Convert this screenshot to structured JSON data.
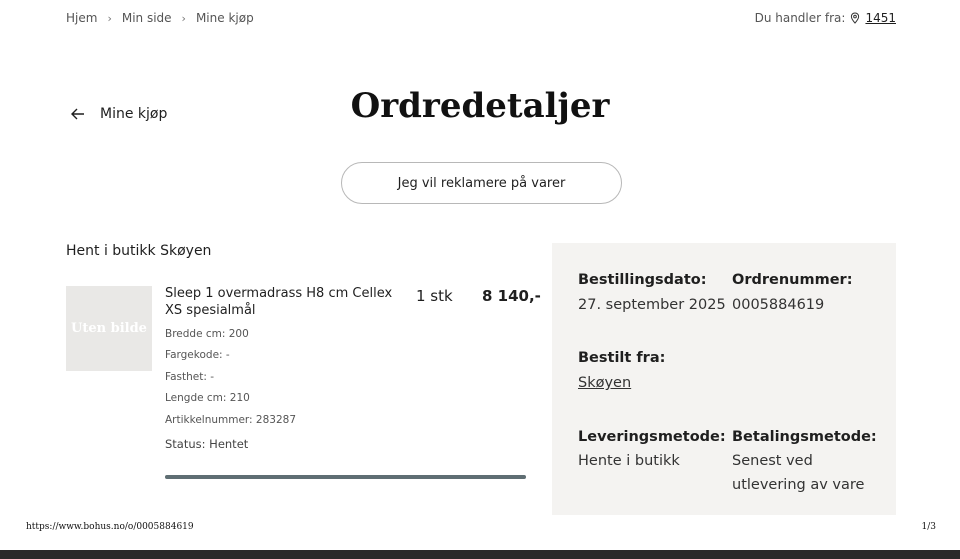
{
  "breadcrumb": {
    "items": [
      "Hjem",
      "Min side",
      "Mine kjøp"
    ]
  },
  "store": {
    "label": "Du handler fra:",
    "icon": "location-pin-icon",
    "name": "1451"
  },
  "header": {
    "back_label": "Mine kjøp",
    "title": "Ordredetaljer"
  },
  "complaint_button": "Jeg vil reklamere på varer",
  "order_lines": {
    "heading": "Hent i butikk Skøyen",
    "item": {
      "image_placeholder": "Uten bilde",
      "name": "Sleep 1 overmadrass H8 cm Cellex XS spesialmål",
      "quantity": "1 stk",
      "price": "8 140,-",
      "attributes": [
        "Bredde cm: 200",
        "Fargekode: -",
        "Fasthet: -",
        "Lengde cm: 210",
        "Artikkelnummer: 283287"
      ],
      "status": "Status: Hentet",
      "progress": 1.0
    }
  },
  "info": {
    "order_date_label": "Bestillingsdato:",
    "order_date_value": "27. september 2025",
    "order_number_label": "Ordrenummer:",
    "order_number_value": "0005884619",
    "ordered_from_label": "Bestilt fra:",
    "ordered_from_value": "Skøyen",
    "delivery_label": "Leveringsmetode:",
    "delivery_value": "Hente i butikk",
    "payment_label": "Betalingsmetode:",
    "payment_value": "Senest ved utlevering av vare"
  },
  "footer": {
    "url": "https://www.bohus.no/o/0005884619",
    "page": "1/3"
  },
  "colors": {
    "panel_bg": "#f4f3f1",
    "progress_fill": "#5f6e73",
    "progress_track": "#d8dcdd"
  }
}
